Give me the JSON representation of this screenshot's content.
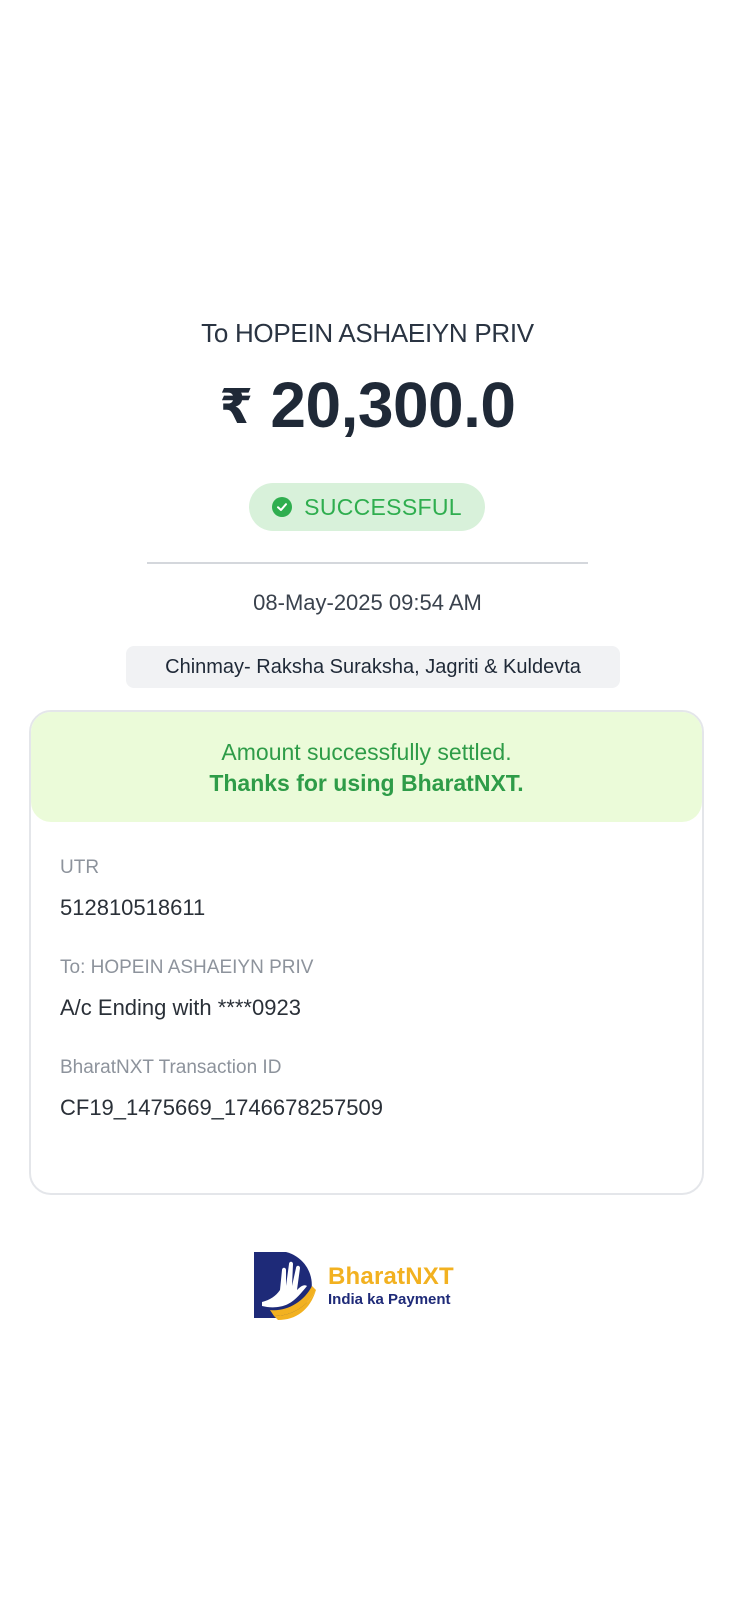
{
  "receipt": {
    "recipient_line": "To HOPEIN ASHAEIYN PRIV",
    "currency_symbol": "₹",
    "amount": "20,300.0",
    "status": "SUCCESSFUL",
    "datetime": "08-May-2025 09:54 AM",
    "note": "Chinmay- Raksha Suraksha, Jagriti & Kuldevta"
  },
  "card": {
    "banner_line1": "Amount successfully settled.",
    "banner_line2": "Thanks for using BharatNXT.",
    "utr_label": "UTR",
    "utr_value": "512810518611",
    "to_label": "To: HOPEIN ASHAEIYN PRIV",
    "account_value": "A/c Ending with ****0923",
    "txn_label": "BharatNXT Transaction ID",
    "txn_value": "CF19_1475669_1746678257509"
  },
  "branding": {
    "brand_name": "BharatNXT",
    "tagline": "India ka Payment"
  },
  "colors": {
    "success_green": "#2fae4f",
    "success_bg": "#d8f1da",
    "banner_bg": "#ebfbd9",
    "brand_yellow": "#f2b120",
    "brand_navy": "#1e2a78"
  },
  "icons": {
    "status": "check-circle-icon",
    "logo": "bharatnxt-hand-logo-icon"
  }
}
